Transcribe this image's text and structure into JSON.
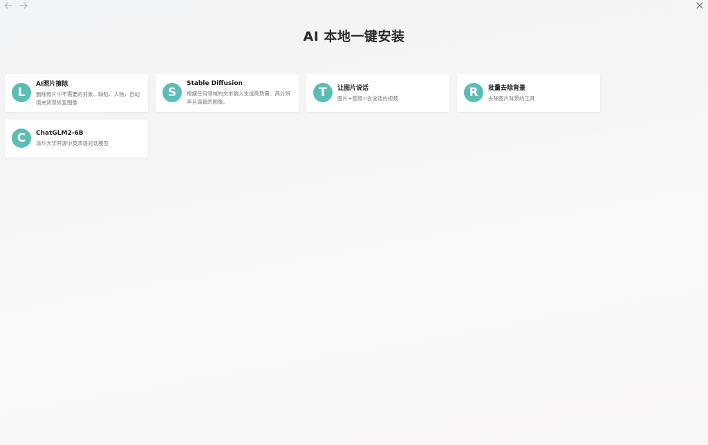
{
  "window": {
    "title": "AI 本地一键安装"
  },
  "nav": {
    "back_icon": "arrow-left-icon",
    "forward_icon": "arrow-right-icon",
    "close_icon": "close-icon"
  },
  "accent_color": "#5bbdb5",
  "cards": [
    {
      "letter": "L",
      "title": "AI照片擦除",
      "desc": "删除照片中不需要的对象、缺陷、人物，自动填充背景修复图像"
    },
    {
      "letter": "S",
      "title": "Stable Diffusion",
      "desc": "根据任何领域的文本输入生成高质量、高分辨率且逼真的图像。"
    },
    {
      "letter": "T",
      "title": "让图片说话",
      "desc": "图片+音频=会说话的视频"
    },
    {
      "letter": "R",
      "title": "批量去除背景",
      "desc": "去除图片背景的工具"
    },
    {
      "letter": "C",
      "title": "ChatGLM2-6B",
      "desc": "清华大学开源中英双语对话模型"
    }
  ]
}
